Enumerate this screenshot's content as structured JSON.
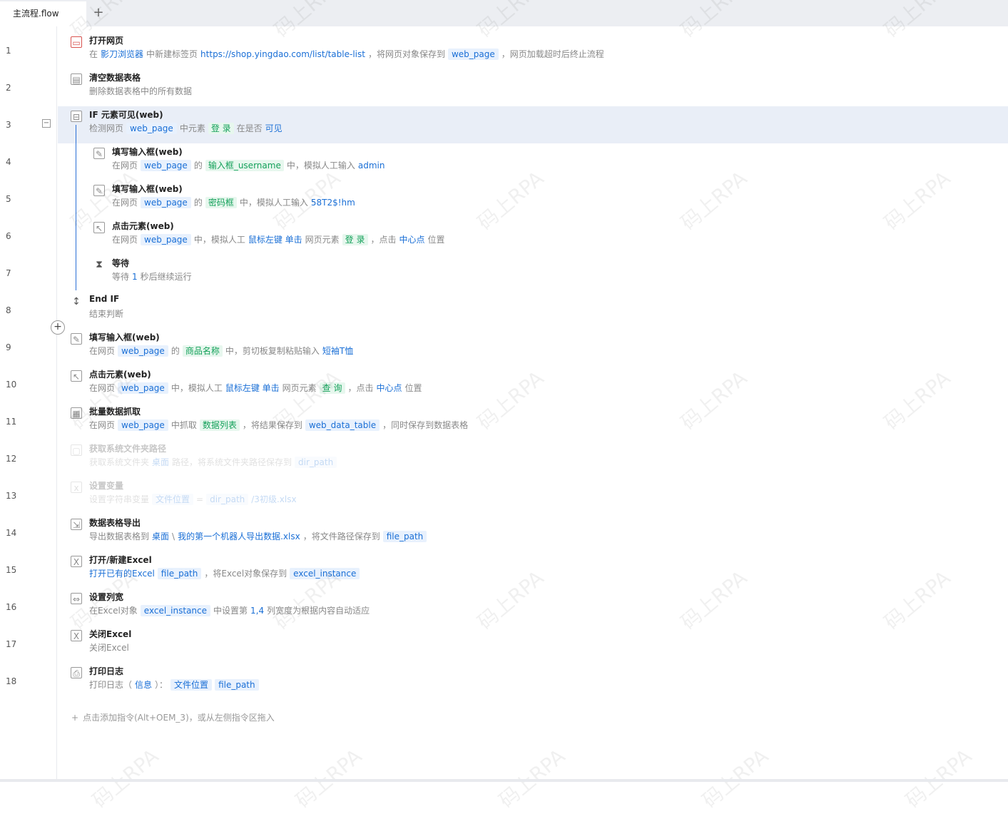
{
  "tab": {
    "label": "主流程.flow",
    "add": "+"
  },
  "watermark": "码上RPA",
  "add_hint": "点击添加指令(Alt+OEM_3)，或从左侧指令区拖入",
  "collapse_symbol": "−",
  "insert_symbol": "+",
  "add_hint_symbol": "+",
  "line_numbers": [
    "1",
    "2",
    "3",
    "4",
    "5",
    "6",
    "7",
    "8",
    "9",
    "10",
    "11",
    "12",
    "13",
    "14",
    "15",
    "16",
    "17",
    "18"
  ],
  "steps": [
    {
      "title": "打开网页",
      "icon": "browser-icon",
      "desc": [
        [
          "t",
          "在"
        ],
        [
          "b",
          "影刀浏览器"
        ],
        [
          "t",
          "中新建标签页"
        ],
        [
          "b",
          "https://shop.yingdao.com/list/table-list"
        ],
        [
          "t",
          "，将网页对象保存到"
        ],
        [
          "v",
          "web_page"
        ],
        [
          "t",
          "，网页加载超时后终止流程"
        ]
      ]
    },
    {
      "title": "清空数据表格",
      "icon": "table-clear-icon",
      "desc": [
        [
          "t",
          "删除数据表格中的所有数据"
        ]
      ]
    },
    {
      "title": "IF 元素可见(web)",
      "icon": "if-element-icon",
      "desc": [
        [
          "t",
          "检测网页"
        ],
        [
          "v",
          "web_page"
        ],
        [
          "t",
          "中元素"
        ],
        [
          "g",
          "登 录"
        ],
        [
          "t",
          "在是否"
        ],
        [
          "b",
          "可见"
        ]
      ]
    },
    {
      "title": "填写输入框(web)",
      "icon": "input-fill-icon",
      "desc": [
        [
          "t",
          "在网页"
        ],
        [
          "v",
          "web_page"
        ],
        [
          "t",
          "的"
        ],
        [
          "g",
          "输入框_username"
        ],
        [
          "t",
          "中，模拟人工输入"
        ],
        [
          "b",
          "admin"
        ]
      ]
    },
    {
      "title": "填写输入框(web)",
      "icon": "input-fill-icon",
      "desc": [
        [
          "t",
          "在网页"
        ],
        [
          "v",
          "web_page"
        ],
        [
          "t",
          "的"
        ],
        [
          "g",
          "密码框"
        ],
        [
          "t",
          "中，模拟人工输入"
        ],
        [
          "b",
          "58T2$!hm"
        ]
      ]
    },
    {
      "title": "点击元素(web)",
      "icon": "click-element-icon",
      "desc": [
        [
          "t",
          "在网页"
        ],
        [
          "v",
          "web_page"
        ],
        [
          "t",
          "中，模拟人工"
        ],
        [
          "b",
          "鼠标左键 单击"
        ],
        [
          "t",
          "网页元素"
        ],
        [
          "g",
          "登 录"
        ],
        [
          "t",
          "，点击"
        ],
        [
          "b",
          "中心点"
        ],
        [
          "t",
          "位置"
        ]
      ]
    },
    {
      "title": "等待",
      "icon": "hourglass-icon",
      "desc": [
        [
          "t",
          "等待"
        ],
        [
          "b",
          "1"
        ],
        [
          "t",
          "秒后继续运行"
        ]
      ]
    },
    {
      "title": "End IF",
      "icon": "end-if-icon",
      "desc": [
        [
          "t",
          "结束判断"
        ]
      ]
    },
    {
      "title": "填写输入框(web)",
      "icon": "input-fill-icon",
      "desc": [
        [
          "t",
          "在网页"
        ],
        [
          "v",
          "web_page"
        ],
        [
          "t",
          "的"
        ],
        [
          "g",
          "商品名称"
        ],
        [
          "t",
          "中，剪切板复制粘贴输入"
        ],
        [
          "b",
          "短袖T恤"
        ]
      ]
    },
    {
      "title": "点击元素(web)",
      "icon": "click-element-icon",
      "desc": [
        [
          "t",
          "在网页"
        ],
        [
          "v",
          "web_page"
        ],
        [
          "t",
          "中，模拟人工"
        ],
        [
          "b",
          "鼠标左键 单击"
        ],
        [
          "t",
          "网页元素"
        ],
        [
          "g",
          "查 询"
        ],
        [
          "t",
          "，点击"
        ],
        [
          "b",
          "中心点"
        ],
        [
          "t",
          "位置"
        ]
      ]
    },
    {
      "title": "批量数据抓取",
      "icon": "data-scrape-icon",
      "desc": [
        [
          "t",
          "在网页"
        ],
        [
          "v",
          "web_page"
        ],
        [
          "t",
          "中抓取"
        ],
        [
          "g",
          "数据列表"
        ],
        [
          "t",
          "，将结果保存到"
        ],
        [
          "v",
          "web_data_table"
        ],
        [
          "t",
          "，同时保存到数据表格"
        ]
      ]
    },
    {
      "title": "获取系统文件夹路径",
      "icon": "folder-icon",
      "disabled": true,
      "desc": [
        [
          "t",
          "获取系统文件夹"
        ],
        [
          "b",
          "桌面"
        ],
        [
          "t",
          "路径，将系统文件夹路径保存到"
        ],
        [
          "v",
          "dir_path"
        ]
      ]
    },
    {
      "title": "设置变量",
      "icon": "variable-icon",
      "disabled": true,
      "desc": [
        [
          "t",
          "设置字符串变量"
        ],
        [
          "v",
          "文件位置"
        ],
        [
          "t",
          "="
        ],
        [
          "v",
          "dir_path"
        ],
        [
          "b",
          "/3初级.xlsx"
        ]
      ]
    },
    {
      "title": "数据表格导出",
      "icon": "table-export-icon",
      "desc": [
        [
          "t",
          "导出数据表格到"
        ],
        [
          "b",
          "桌面"
        ],
        [
          "t",
          "\\"
        ],
        [
          "b",
          "我的第一个机器人导出数据.xlsx"
        ],
        [
          "t",
          "，将文件路径保存到"
        ],
        [
          "v",
          "file_path"
        ]
      ]
    },
    {
      "title": "打开/新建Excel",
      "icon": "excel-open-icon",
      "desc": [
        [
          "b",
          "打开已有的Excel"
        ],
        [
          "v",
          "file_path"
        ],
        [
          "t",
          "，将Excel对象保存到"
        ],
        [
          "v",
          "excel_instance"
        ]
      ]
    },
    {
      "title": "设置列宽",
      "icon": "column-width-icon",
      "desc": [
        [
          "t",
          "在Excel对象"
        ],
        [
          "v",
          "excel_instance"
        ],
        [
          "t",
          "中设置第"
        ],
        [
          "b",
          "1,4"
        ],
        [
          "t",
          "列宽度为根据内容自动适应"
        ]
      ]
    },
    {
      "title": "关闭Excel",
      "icon": "excel-close-icon",
      "desc": [
        [
          "t",
          "关闭Excel"
        ]
      ]
    },
    {
      "title": "打印日志",
      "icon": "print-log-icon",
      "desc": [
        [
          "t",
          "打印日志（"
        ],
        [
          "b",
          "信息"
        ],
        [
          "t",
          "）："
        ],
        [
          "v",
          "文件位置"
        ],
        [
          "v",
          "file_path"
        ]
      ]
    }
  ]
}
